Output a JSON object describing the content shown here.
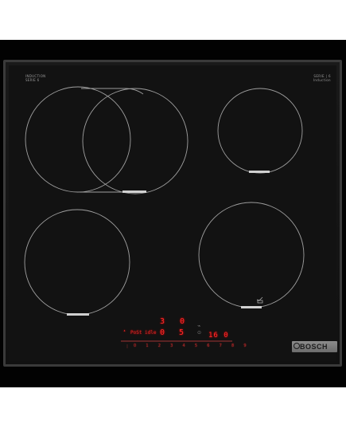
{
  "labels": {
    "top_left_line1": "INDUCTION",
    "top_left_line2": "SERIE 6",
    "top_right_line1": "SERIE | 6",
    "top_right_line2": "Induction",
    "brand": "BOSCH"
  },
  "display": {
    "zone_rear_left_level": "3",
    "zone_rear_right_level": "0",
    "zone_front_left_level": "0",
    "zone_front_right_level": "5",
    "control_text": "PoSt idle",
    "timer": "16 0",
    "slider_scale": "0 1 2 3 4 5 6 7 8 9"
  },
  "icons": [
    "flex-zone-icon",
    "power-boost-icon",
    "timer-icon",
    "brand-logo-icon"
  ],
  "colors": {
    "glass": "#121212",
    "frame": "#3a3a3a",
    "display_red": "#ff2a2a",
    "brand_plate": "#7c7c7c"
  }
}
